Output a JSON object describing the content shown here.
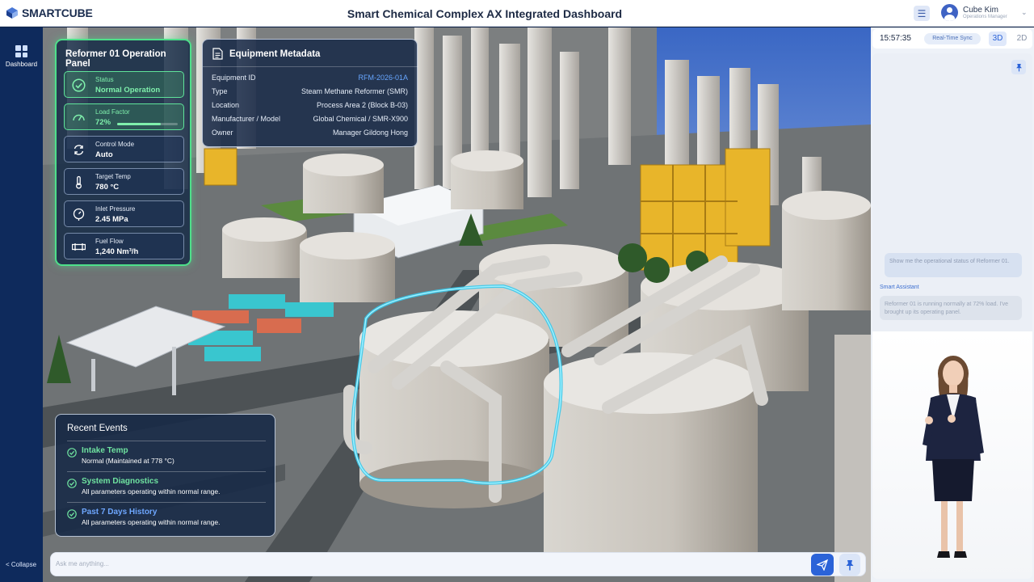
{
  "header": {
    "logo_text": "SMARTCUBE",
    "title": "Smart Chemical Complex AX Integrated Dashboard",
    "menu_icon": "menu-icon",
    "user": {
      "name": "Cube Kim",
      "role": "Operations Manager"
    }
  },
  "nav": {
    "items": [
      {
        "label": "Dashboard",
        "icon": "dashboard-icon"
      }
    ],
    "collapse_label": "< Collapse"
  },
  "reformer_panel": {
    "title": "Reformer 01 Operation Panel",
    "stats": [
      {
        "label": "Status",
        "value": "Normal Operation",
        "icon": "check-circle-icon",
        "highlight": true
      },
      {
        "label": "Load Factor",
        "value": "72%",
        "icon": "gauge-icon",
        "highlight": true,
        "progress": 0.72
      },
      {
        "label": "Control Mode",
        "value": "Auto",
        "icon": "refresh-icon",
        "highlight": false
      },
      {
        "label": "Target Temp",
        "value": "780 °C",
        "icon": "thermometer-icon",
        "highlight": false
      },
      {
        "label": "Inlet Pressure",
        "value": "2.45 MPa",
        "icon": "pressure-gauge-icon",
        "highlight": false
      },
      {
        "label": "Fuel Flow",
        "value": "1,240 Nm³/h",
        "icon": "pipe-flow-icon",
        "highlight": false
      }
    ]
  },
  "metadata": {
    "title": "Equipment Metadata",
    "rows": [
      {
        "key": "Equipment ID",
        "value": "RFM-2026-01A"
      },
      {
        "key": "Type",
        "value": "Steam Methane Reformer (SMR)"
      },
      {
        "key": "Location",
        "value": "Process Area 2 (Block B-03)"
      },
      {
        "key": "Manufacturer / Model",
        "value": "Global Chemical / SMR-X900"
      },
      {
        "key": "Owner",
        "value": "Manager Gildong Hong"
      }
    ]
  },
  "events": {
    "title": "Recent Events",
    "items": [
      {
        "title": "Intake Temp",
        "desc": "Normal (Maintained at 778 °C)",
        "color": "#6fe3a0"
      },
      {
        "title": "System Diagnostics",
        "desc": "All parameters operating within normal range.",
        "color": "#6fe3a0"
      },
      {
        "title": "Past 7 Days History",
        "desc": "All parameters operating within normal range.",
        "color": "#6ea7ff"
      }
    ]
  },
  "ask": {
    "placeholder": "Ask me anything..."
  },
  "right_panel": {
    "clock": "15:57:35",
    "sync_label": "Real-Time Sync",
    "view_3d": "3D",
    "view_2d": "2D",
    "user_message": "Show me the operational status of Reformer 01.",
    "assistant_label": "Smart Assistant",
    "assistant_message": "Reformer 01 is running normally at 72% load. I've brought up its operating panel."
  },
  "colors": {
    "accent": "#2b63d8",
    "ok": "#4ee08a",
    "nav": "#0e2a5c",
    "highlight": "#39c8ea"
  }
}
